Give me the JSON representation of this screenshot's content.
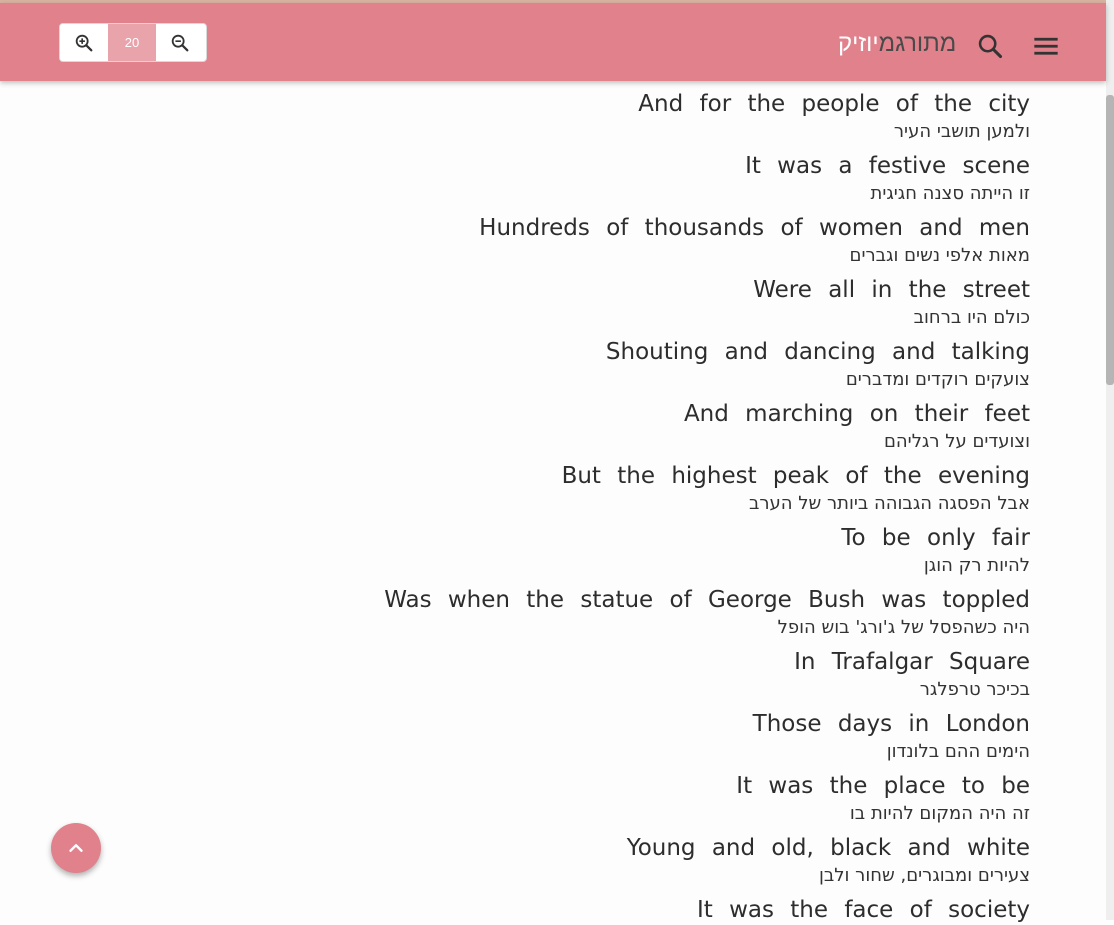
{
  "header": {
    "logo_dark": "מתורגמ",
    "logo_light": "יוזיק",
    "zoom_in_icon": "zoom-in-icon",
    "zoom_out_icon": "zoom-out-icon",
    "font_size": "20",
    "search_icon": "search-icon",
    "menu_icon": "menu-icon"
  },
  "colors": {
    "header_bg": "#e0818c",
    "zoom_value_bg": "#e9a3ab",
    "fab_bg": "#e0818c"
  },
  "lyrics": [
    {
      "en": "And for the people of the city",
      "he": "ולמען תושבי העיר"
    },
    {
      "en": "It was a festive scene",
      "he": "זו הייתה סצנה חגיגית"
    },
    {
      "en": "Hundreds of thousands of women and men",
      "he": "מאות אלפי נשים וגברים"
    },
    {
      "en": "Were all in the street",
      "he": "כולם היו ברחוב"
    },
    {
      "en": "Shouting and dancing and talking",
      "he": "צועקים רוקדים ומדברים"
    },
    {
      "en": "And marching on their feet",
      "he": "וצועדים על רגליהם"
    },
    {
      "en": "But the highest peak of the evening",
      "he": "אבל הפסגה הגבוהה ביותר של הערב"
    },
    {
      "en": "To be only fair",
      "he": "להיות רק הוגן"
    },
    {
      "en": "Was when the statue of George Bush was toppled",
      "he": "היה כשהפסל של ג'ורג' בוש הופל"
    },
    {
      "en": "In Trafalgar Square",
      "he": "בכיכר טרפלגר"
    },
    {
      "en": "Those days in London",
      "he": "הימים ההם בלונדון"
    },
    {
      "en": "It was the place to be",
      "he": "זה היה המקום להיות בו"
    },
    {
      "en": "Young and old, black and white",
      "he": "צעירים ומבוגרים, שחור ולבן"
    },
    {
      "en": "It was the face of society",
      "he": ""
    }
  ],
  "scroll_top_icon": "chevron-up-icon"
}
